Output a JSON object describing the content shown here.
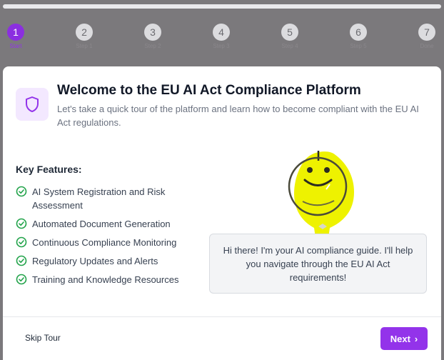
{
  "steps": [
    {
      "number": "1",
      "label": "Start",
      "active": true
    },
    {
      "number": "2",
      "label": "Step 1"
    },
    {
      "number": "3",
      "label": "Step 2"
    },
    {
      "number": "4",
      "label": "Step 3"
    },
    {
      "number": "5",
      "label": "Step 4"
    },
    {
      "number": "6",
      "label": "Step 5"
    },
    {
      "number": "7",
      "label": "Done"
    }
  ],
  "header": {
    "icon": "shield-icon",
    "title": "Welcome to the EU AI Act Compliance Platform",
    "subtitle": "Let's take a quick tour of the platform and learn how to become compliant with the EU AI Act regulations."
  },
  "features": {
    "title": "Key Features:",
    "items": [
      "AI System Registration and Risk Assessment",
      "Automated Document Generation",
      "Continuous Compliance Monitoring",
      "Regulatory Updates and Alerts",
      "Training and Knowledge Resources"
    ]
  },
  "mascot": {
    "icon": "smiley-mascot-icon"
  },
  "bubble": {
    "text": "Hi there! I'm your AI compliance guide. I'll help you navigate through the EU AI Act requirements!"
  },
  "footer": {
    "skip_label": "Skip Tour",
    "next_label": "Next"
  },
  "colors": {
    "accent": "#9333ea",
    "mascot": "#eef200",
    "check": "#22a34a"
  }
}
